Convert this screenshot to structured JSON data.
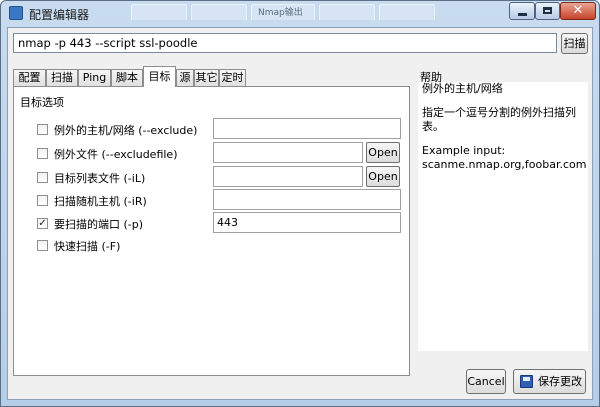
{
  "window": {
    "title": "配置编辑器",
    "background_tabs": [
      "",
      "",
      "Nmap输出",
      "",
      ""
    ]
  },
  "command": {
    "value": "nmap -p 443 --script ssl-poodle"
  },
  "scan_button": {
    "label": "扫描"
  },
  "tabs": [
    {
      "label": "配置"
    },
    {
      "label": "扫描"
    },
    {
      "label": "Ping"
    },
    {
      "label": "脚本"
    },
    {
      "label": "目标"
    },
    {
      "label": "源"
    },
    {
      "label": "其它"
    },
    {
      "label": "定时"
    }
  ],
  "active_tab": "目标",
  "target_section": {
    "title": "目标选项",
    "options": [
      {
        "label": "例外的主机/网络 (--exclude)",
        "checked": false,
        "value": "",
        "has_open": false
      },
      {
        "label": "例外文件 (--excludefile)",
        "checked": false,
        "value": "",
        "has_open": true
      },
      {
        "label": "目标列表文件 (-iL)",
        "checked": false,
        "value": "",
        "has_open": true
      },
      {
        "label": "扫描随机主机 (-iR)",
        "checked": false,
        "value": "",
        "has_open": false
      },
      {
        "label": "要扫描的端口 (-p)",
        "checked": true,
        "value": "443",
        "has_open": false
      },
      {
        "label": "快速扫描 (-F)",
        "checked": false,
        "value": null,
        "has_open": false
      }
    ],
    "open_label": "Open"
  },
  "help": {
    "title": "帮助",
    "heading": "例外的主机/网络",
    "description": "指定一个逗号分割的例外扫描列表。",
    "example_label": "Example input:",
    "example_value": "scanme.nmap.org,foobar.com"
  },
  "buttons": {
    "cancel": "Cancel",
    "save": "保存更改"
  },
  "icons": [
    "app-icon",
    "minimize-icon",
    "maximize-icon",
    "close-icon",
    "save-icon"
  ]
}
